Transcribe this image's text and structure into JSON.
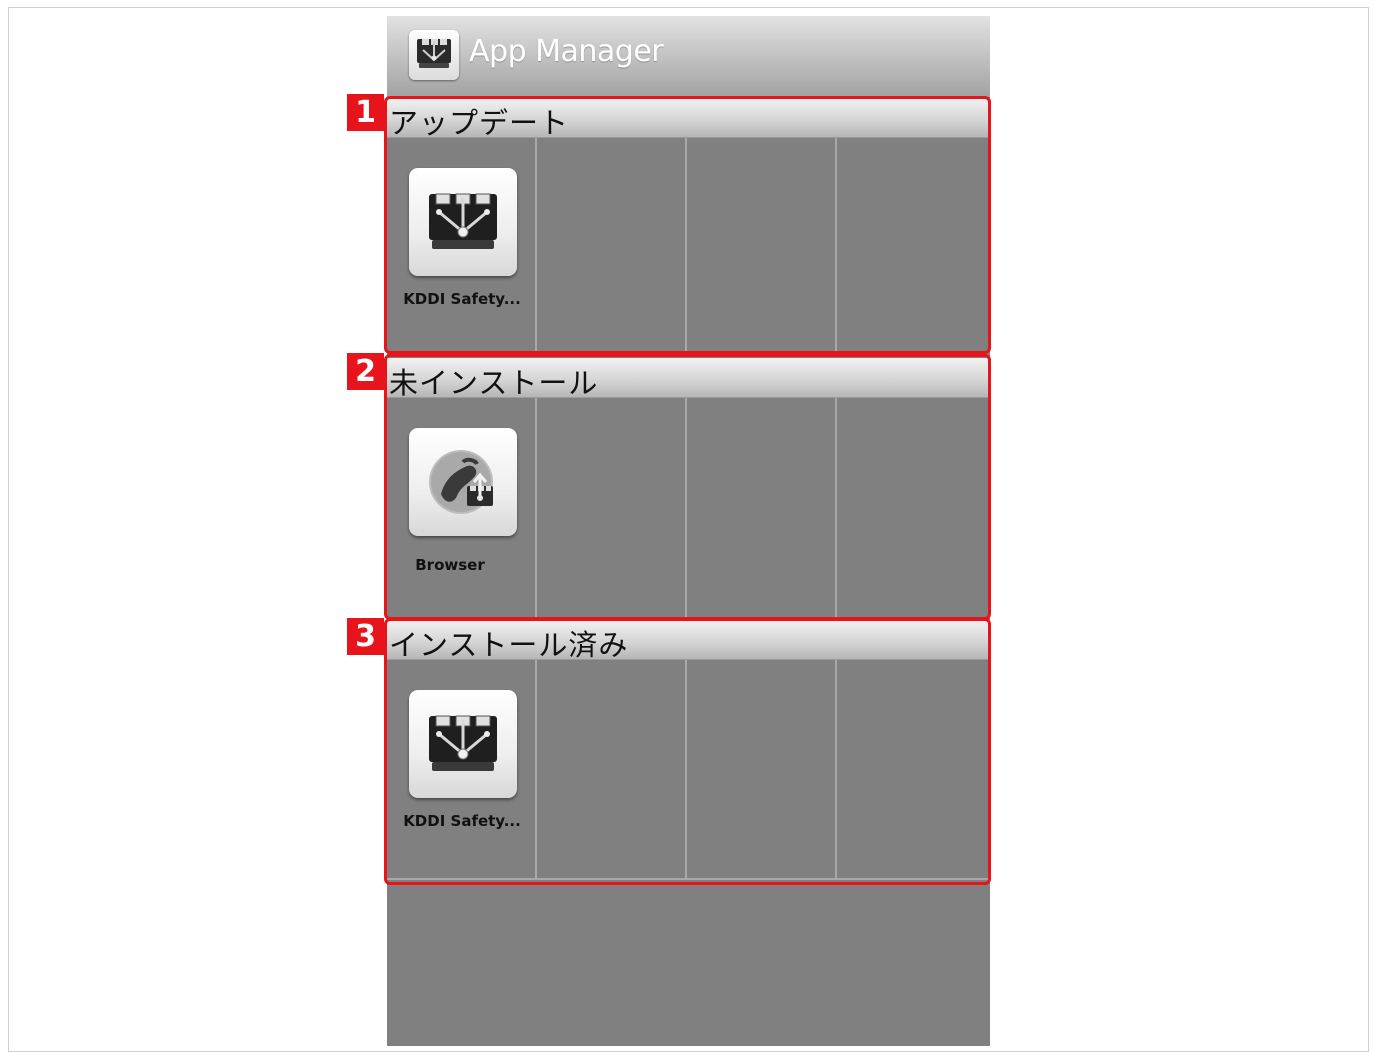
{
  "app": {
    "title": "App Manager",
    "icon": "app-manager-icon"
  },
  "sections": [
    {
      "badge": "1",
      "title": "アップデート",
      "apps": [
        {
          "label": "KDDI Safety...",
          "icon": "kddi-safety-icon"
        }
      ]
    },
    {
      "badge": "2",
      "title": "未インストール",
      "apps": [
        {
          "label": "Browser",
          "icon": "browser-icon"
        }
      ]
    },
    {
      "badge": "3",
      "title": "インストール済み",
      "apps": [
        {
          "label": "KDDI Safety...",
          "icon": "kddi-safety-icon"
        }
      ]
    }
  ],
  "colors": {
    "highlight": "#e8141c",
    "background": "#808080"
  }
}
